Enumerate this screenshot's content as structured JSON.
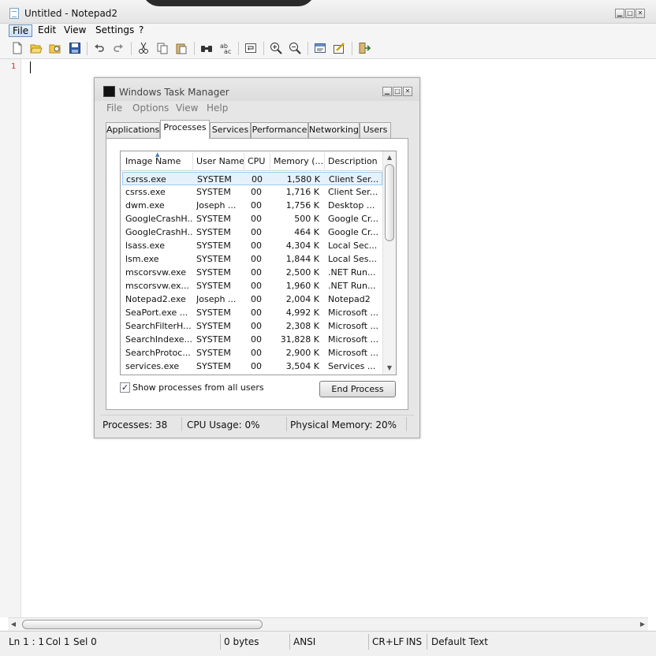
{
  "notepad": {
    "title": "Untitled - Notepad2",
    "window_buttons": [
      "▁",
      "□",
      "✕"
    ],
    "menu": [
      "File",
      "Edit",
      "View",
      "Settings",
      "?"
    ],
    "line_number": "1",
    "status": {
      "position": "Ln 1 : 1",
      "col": "Col 1",
      "sel": "Sel 0",
      "size": "0 bytes",
      "encoding": "ANSI",
      "eol": "CR+LF",
      "ins": "INS",
      "scheme": "Default Text"
    },
    "toolbar_icons": [
      "new-file-icon",
      "open-folder-icon",
      "browse-icon",
      "save-icon",
      "undo-icon",
      "redo-icon",
      "cut-icon",
      "copy-icon",
      "paste-icon",
      "find-icon",
      "replace-icon",
      "word-wrap-icon",
      "zoom-in-icon",
      "zoom-out-icon",
      "scheme-icon",
      "customize-icon",
      "exit-icon"
    ]
  },
  "taskmgr": {
    "title": "Windows Task Manager",
    "menu": [
      "File",
      "Options",
      "View",
      "Help"
    ],
    "tabs": [
      "Applications",
      "Processes",
      "Services",
      "Performance",
      "Networking",
      "Users"
    ],
    "active_tab": "Processes",
    "columns": [
      "Image Name",
      "User Name",
      "CPU",
      "Memory (...",
      "Description"
    ],
    "rows": [
      [
        "csrss.exe",
        "SYSTEM",
        "00",
        "1,580 K",
        "Client Ser..."
      ],
      [
        "csrss.exe",
        "SYSTEM",
        "00",
        "1,716 K",
        "Client Ser..."
      ],
      [
        "dwm.exe",
        "Joseph ...",
        "00",
        "1,756 K",
        "Desktop ..."
      ],
      [
        "GoogleCrashH...",
        "SYSTEM",
        "00",
        "500 K",
        "Google Cr..."
      ],
      [
        "GoogleCrashH...",
        "SYSTEM",
        "00",
        "464 K",
        "Google Cr..."
      ],
      [
        "lsass.exe",
        "SYSTEM",
        "00",
        "4,304 K",
        "Local Sec..."
      ],
      [
        "lsm.exe",
        "SYSTEM",
        "00",
        "1,844 K",
        "Local Ses..."
      ],
      [
        "mscorsvw.exe",
        "SYSTEM",
        "00",
        "2,500 K",
        ".NET Run..."
      ],
      [
        "mscorsvw.ex...",
        "SYSTEM",
        "00",
        "1,960 K",
        ".NET Run..."
      ],
      [
        "Notepad2.exe",
        "Joseph ...",
        "00",
        "2,004 K",
        "Notepad2"
      ],
      [
        "SeaPort.exe ...",
        "SYSTEM",
        "00",
        "4,992 K",
        "Microsoft ..."
      ],
      [
        "SearchFilterH...",
        "SYSTEM",
        "00",
        "2,308 K",
        "Microsoft ..."
      ],
      [
        "SearchIndexe...",
        "SYSTEM",
        "00",
        "31,828 K",
        "Microsoft ..."
      ],
      [
        "SearchProtoc...",
        "SYSTEM",
        "00",
        "2,900 K",
        "Microsoft ..."
      ],
      [
        "services.exe",
        "SYSTEM",
        "00",
        "3,504 K",
        "Services ..."
      ]
    ],
    "show_all_label": "Show processes from all users",
    "show_all_checked": true,
    "checkmark": "✓",
    "end_process_label": "End Process",
    "status": {
      "processes": "Processes: 38",
      "cpu": "CPU Usage: 0%",
      "memory": "Physical Memory: 20%"
    }
  }
}
